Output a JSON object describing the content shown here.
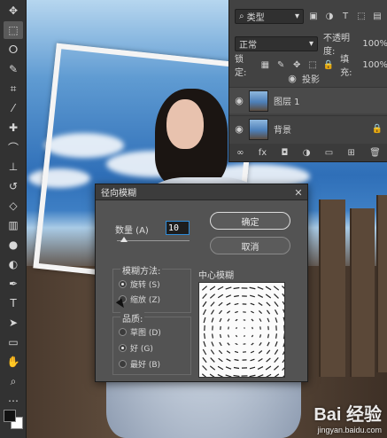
{
  "layers_panel": {
    "filter_kind": "类型",
    "blend_mode": "正常",
    "opacity_label": "不透明度:",
    "opacity_value": "100%",
    "lock_label": "锁定:",
    "fill_label": "填充:",
    "fill_value": "100%",
    "effect_name": "投影",
    "layers": [
      {
        "name": "图层 1"
      },
      {
        "name": "背景"
      }
    ],
    "footer_fx": "fx"
  },
  "dialog": {
    "title": "径向模糊",
    "amount_label": "数量 (A)",
    "amount_value": "10",
    "amount_fraction": 0.1,
    "ok_label": "确定",
    "cancel_label": "取消",
    "method_group_title": "模糊方法:",
    "method_options": [
      {
        "label": "旋转 (S)",
        "selected": true
      },
      {
        "label": "缩放 (Z)",
        "selected": false
      }
    ],
    "quality_group_title": "品质:",
    "quality_options": [
      {
        "label": "草图 (D)",
        "selected": false
      },
      {
        "label": "好 (G)",
        "selected": true
      },
      {
        "label": "最好 (B)",
        "selected": false
      }
    ],
    "center_label": "中心模糊"
  },
  "watermark": {
    "logo": "Bai 经验",
    "url": "jingyan.baidu.com"
  },
  "colors": {
    "panel_bg": "#424242",
    "dialog_bg": "#535353",
    "accent_blue": "#2e8bd8"
  }
}
